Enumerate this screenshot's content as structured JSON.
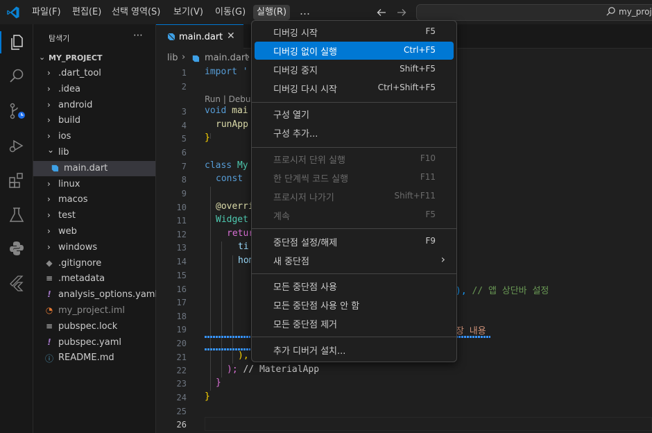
{
  "menubar": {
    "items": [
      {
        "label": "파일(F)"
      },
      {
        "label": "편집(E)"
      },
      {
        "label": "선택 영역(S)"
      },
      {
        "label": "보기(V)"
      },
      {
        "label": "이동(G)"
      },
      {
        "label": "실행(R)"
      }
    ],
    "more_icon": "…",
    "back_icon": "arrow-left-icon",
    "forward_icon": "arrow-right-icon",
    "search_text": "my_project"
  },
  "sidebar": {
    "title": "탐색기",
    "project": "MY_PROJECT",
    "items": [
      {
        "label": ".dart_tool",
        "type": "folder",
        "expanded": false
      },
      {
        "label": ".idea",
        "type": "folder",
        "expanded": false
      },
      {
        "label": "android",
        "type": "folder",
        "expanded": false
      },
      {
        "label": "build",
        "type": "folder",
        "expanded": false
      },
      {
        "label": "ios",
        "type": "folder",
        "expanded": false
      },
      {
        "label": "lib",
        "type": "folder",
        "expanded": true
      },
      {
        "label": "main.dart",
        "type": "dart-file",
        "selected": true
      },
      {
        "label": "linux",
        "type": "folder",
        "expanded": false
      },
      {
        "label": "macos",
        "type": "folder",
        "expanded": false
      },
      {
        "label": "test",
        "type": "folder",
        "expanded": false
      },
      {
        "label": "web",
        "type": "folder",
        "expanded": false
      },
      {
        "label": "windows",
        "type": "folder",
        "expanded": false
      },
      {
        "label": ".gitignore",
        "type": "git-file"
      },
      {
        "label": ".metadata",
        "type": "list-file"
      },
      {
        "label": "analysis_options.yaml",
        "type": "yaml-file"
      },
      {
        "label": "my_project.iml",
        "type": "rss-file"
      },
      {
        "label": "pubspec.lock",
        "type": "list-file"
      },
      {
        "label": "pubspec.yaml",
        "type": "yaml-file"
      },
      {
        "label": "README.md",
        "type": "info-file"
      }
    ]
  },
  "editor": {
    "tab_label": "main.dart",
    "breadcrumb": [
      "lib",
      "main.dart"
    ],
    "codelens": "Run | Debug",
    "lines": {
      "l1": "import '",
      "l3a": "void ",
      "l3b": "mai",
      "l4": "runApp",
      "l5": "}",
      "l7a": "class ",
      "l7b": "My",
      "l8": "const ",
      "l10": "@overri",
      "l11": "Widget",
      "l12": "retur",
      "l13": "ti",
      "l14": "hom",
      "l16a": "),",
      "l16b": " // 앱 상단바 설정",
      "l19": "장 내용",
      "l21": "),",
      "l22a": "); ",
      "l22b": "// MaterialApp",
      "l23": "}",
      "l24": "}"
    },
    "line_numbers": [
      "1",
      "2",
      "3",
      "4",
      "5",
      "6",
      "7",
      "8",
      "9",
      "10",
      "11",
      "12",
      "13",
      "14",
      "15",
      "16",
      "17",
      "18",
      "19",
      "20",
      "21",
      "22",
      "23",
      "24",
      "25",
      "26"
    ]
  },
  "run_menu": {
    "items": [
      {
        "label": "디버깅 시작",
        "key": "F5"
      },
      {
        "label": "디버깅 없이 실행",
        "key": "Ctrl+F5",
        "highlighted": true
      },
      {
        "label": "디버깅 중지",
        "key": "Shift+F5"
      },
      {
        "label": "디버깅 다시 시작",
        "key": "Ctrl+Shift+F5"
      },
      {
        "label": "구성 열기",
        "key": ""
      },
      {
        "label": "구성 추가...",
        "key": ""
      },
      {
        "label": "프로시저 단위 실행",
        "key": "F10",
        "disabled": true
      },
      {
        "label": "한 단계씩 코드 실행",
        "key": "F11",
        "disabled": true
      },
      {
        "label": "프로시저 나가기",
        "key": "Shift+F11",
        "disabled": true
      },
      {
        "label": "계속",
        "key": "F5",
        "disabled": true
      },
      {
        "label": "중단점 설정/해제",
        "key": "F9"
      },
      {
        "label": "새 중단점",
        "key": "",
        "submenu": true
      },
      {
        "label": "모든 중단점 사용",
        "key": ""
      },
      {
        "label": "모든 중단점 사용 안 함",
        "key": ""
      },
      {
        "label": "모든 중단점 제거",
        "key": ""
      },
      {
        "label": "추가 디버거 설치...",
        "key": ""
      }
    ]
  },
  "colors": {
    "accent": "#0078d4",
    "background": "#1f1f1f",
    "sidebar": "#181818"
  }
}
